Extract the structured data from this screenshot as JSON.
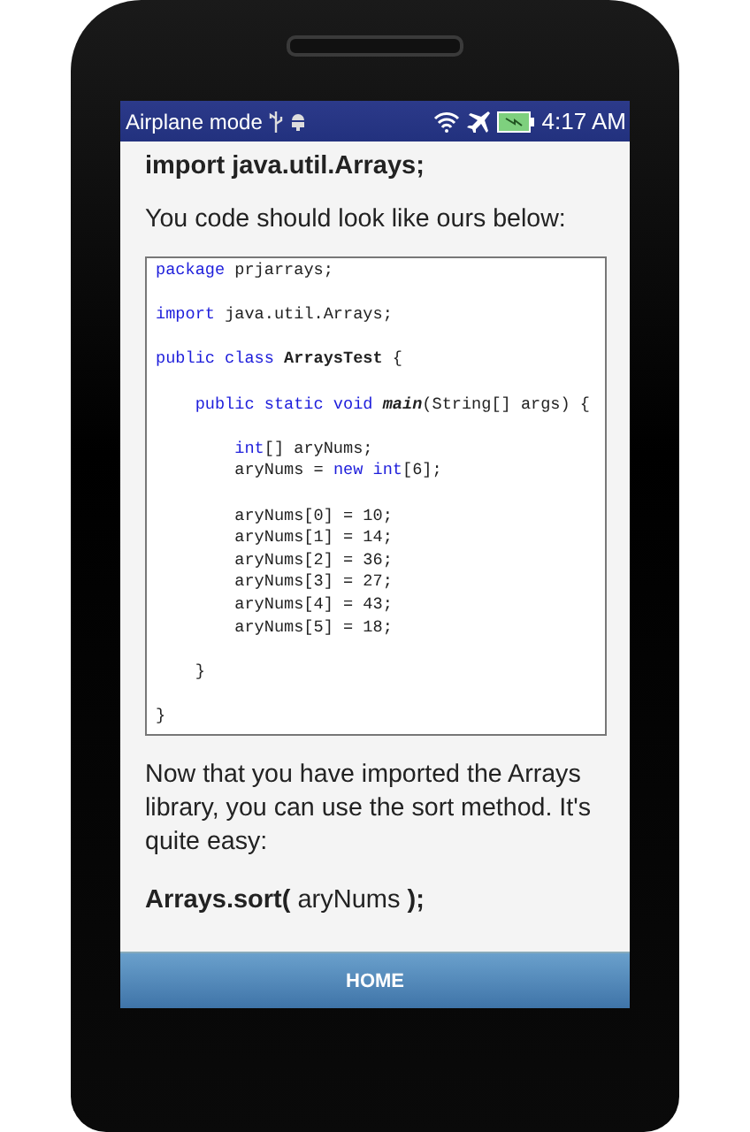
{
  "status_bar": {
    "left_text": "Airplane mode",
    "time": "4:17 AM"
  },
  "content": {
    "heading": "import java.util.Arrays;",
    "intro": "You code should look like ours below:",
    "code_groups": [
      [
        [
          {
            "text": "package",
            "kind": "keyword"
          },
          {
            "text": " prjarrays;",
            "kind": "plain"
          }
        ]
      ],
      [
        [
          {
            "text": "import",
            "kind": "keyword"
          },
          {
            "text": " java.util.Arrays;",
            "kind": "plain"
          }
        ]
      ],
      [
        [
          {
            "text": "public class ",
            "kind": "keyword"
          },
          {
            "text": "ArraysTest",
            "kind": "type"
          },
          {
            "text": " {",
            "kind": "plain"
          }
        ]
      ],
      [
        [
          {
            "text": "    public static void ",
            "kind": "keyword"
          },
          {
            "text": "main",
            "kind": "method"
          },
          {
            "text": "(String[] args) {",
            "kind": "plain"
          }
        ]
      ],
      [
        [
          {
            "text": "        int",
            "kind": "keyword"
          },
          {
            "text": "[] aryNums;",
            "kind": "plain"
          }
        ],
        [
          {
            "text": "        aryNums = ",
            "kind": "plain"
          },
          {
            "text": "new int",
            "kind": "keyword"
          },
          {
            "text": "[6];",
            "kind": "plain"
          }
        ]
      ],
      [
        [
          {
            "text": "        aryNums[0] = 10;",
            "kind": "plain"
          }
        ],
        [
          {
            "text": "        aryNums[1] = 14;",
            "kind": "plain"
          }
        ],
        [
          {
            "text": "        aryNums[2] = 36;",
            "kind": "plain"
          }
        ],
        [
          {
            "text": "        aryNums[3] = 27;",
            "kind": "plain"
          }
        ],
        [
          {
            "text": "        aryNums[4] = 43;",
            "kind": "plain"
          }
        ],
        [
          {
            "text": "        aryNums[5] = 18;",
            "kind": "plain"
          }
        ]
      ],
      [
        [
          {
            "text": "    }",
            "kind": "plain"
          }
        ]
      ],
      [
        [
          {
            "text": "}",
            "kind": "plain"
          }
        ]
      ]
    ],
    "paragraph": "Now that you have imported the Arrays library, you can use the sort method. It's quite easy:",
    "example": "**Arrays.sort(** aryNums **);**"
  },
  "footer": {
    "button": "HOME"
  }
}
